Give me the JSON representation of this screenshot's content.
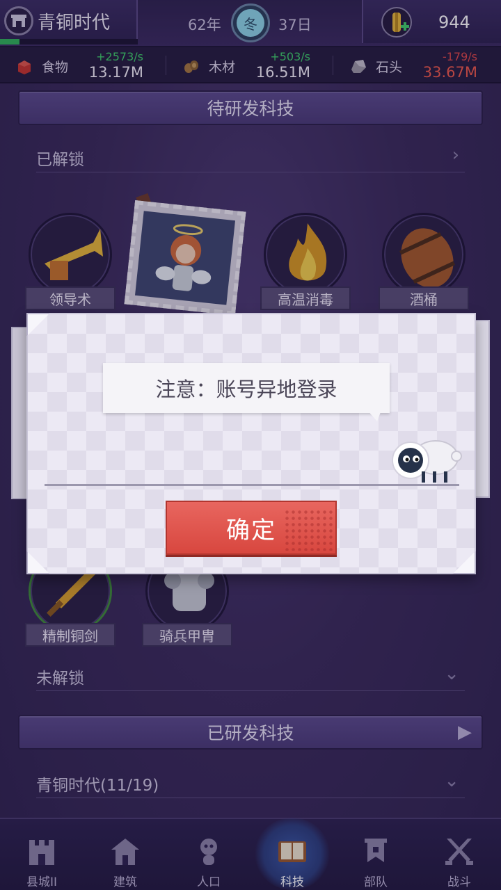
{
  "header": {
    "era_title": "青铜时代",
    "era_progress_fraction": 0.14,
    "year": "62年",
    "season": "冬",
    "day": "37日",
    "gold": "944"
  },
  "resources": [
    {
      "name": "食物",
      "rate": "+2573/s",
      "amount": "13.17M",
      "rate_color": "#3fd16b",
      "amount_color": "#f4f1fa"
    },
    {
      "name": "木材",
      "rate": "+503/s",
      "amount": "16.51M",
      "rate_color": "#3fd16b",
      "amount_color": "#f4f1fa"
    },
    {
      "name": "石头",
      "rate": "-179/s",
      "amount": "33.67M",
      "rate_color": "#e04848",
      "amount_color": "#ef5a4b"
    }
  ],
  "sections": {
    "pending_banner": "待研发科技",
    "unlocked_header": "已解锁",
    "locked_header": "未解锁",
    "researched_banner": "已研发科技",
    "era_header": "青铜时代(11/19)"
  },
  "tech_row1": [
    {
      "label": "领导术",
      "icon": "trumpet-icon"
    },
    {
      "label": "",
      "icon": "angel-icon"
    },
    {
      "label": "高温消毒",
      "icon": "fire-icon"
    },
    {
      "label": "酒桶",
      "icon": "barrel-icon"
    }
  ],
  "tech_row2": [
    {
      "label": "精制铜剑",
      "icon": "sword-icon"
    },
    {
      "label": "骑兵甲胄",
      "icon": "armor-icon"
    }
  ],
  "dialog": {
    "message": "注意：账号异地登录",
    "confirm_label": "确定"
  },
  "nav": [
    {
      "label": "县城II",
      "icon": "castle-icon"
    },
    {
      "label": "建筑",
      "icon": "house-icon"
    },
    {
      "label": "人口",
      "icon": "person-icon"
    },
    {
      "label": "科技",
      "icon": "book-icon",
      "active": true
    },
    {
      "label": "部队",
      "icon": "banner-icon"
    },
    {
      "label": "战斗",
      "icon": "crossed-swords-icon"
    }
  ],
  "colors": {
    "accent_red": "#d8473f",
    "positive": "#3fd16b",
    "negative": "#e04848"
  }
}
